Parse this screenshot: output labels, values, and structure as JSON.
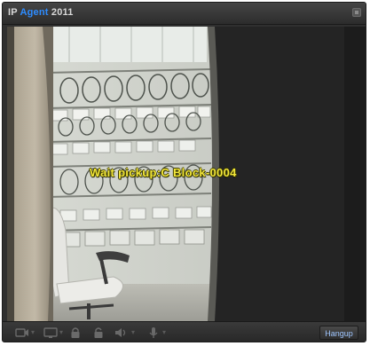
{
  "window": {
    "title_prefix": "IP",
    "title_accent": "Agent",
    "title_suffix": "2011"
  },
  "video": {
    "overlay_text": "Wait pickup:C Block-0004"
  },
  "toolbar": {
    "hangup_label": "Hangup",
    "icons": [
      "video-icon",
      "screen-icon",
      "lock-icon",
      "unlock-icon",
      "speaker-icon",
      "microphone-icon"
    ]
  },
  "colors": {
    "accent": "#2d8cff",
    "overlay_text": "#f2e63a",
    "frame": "#2f2f2f"
  }
}
